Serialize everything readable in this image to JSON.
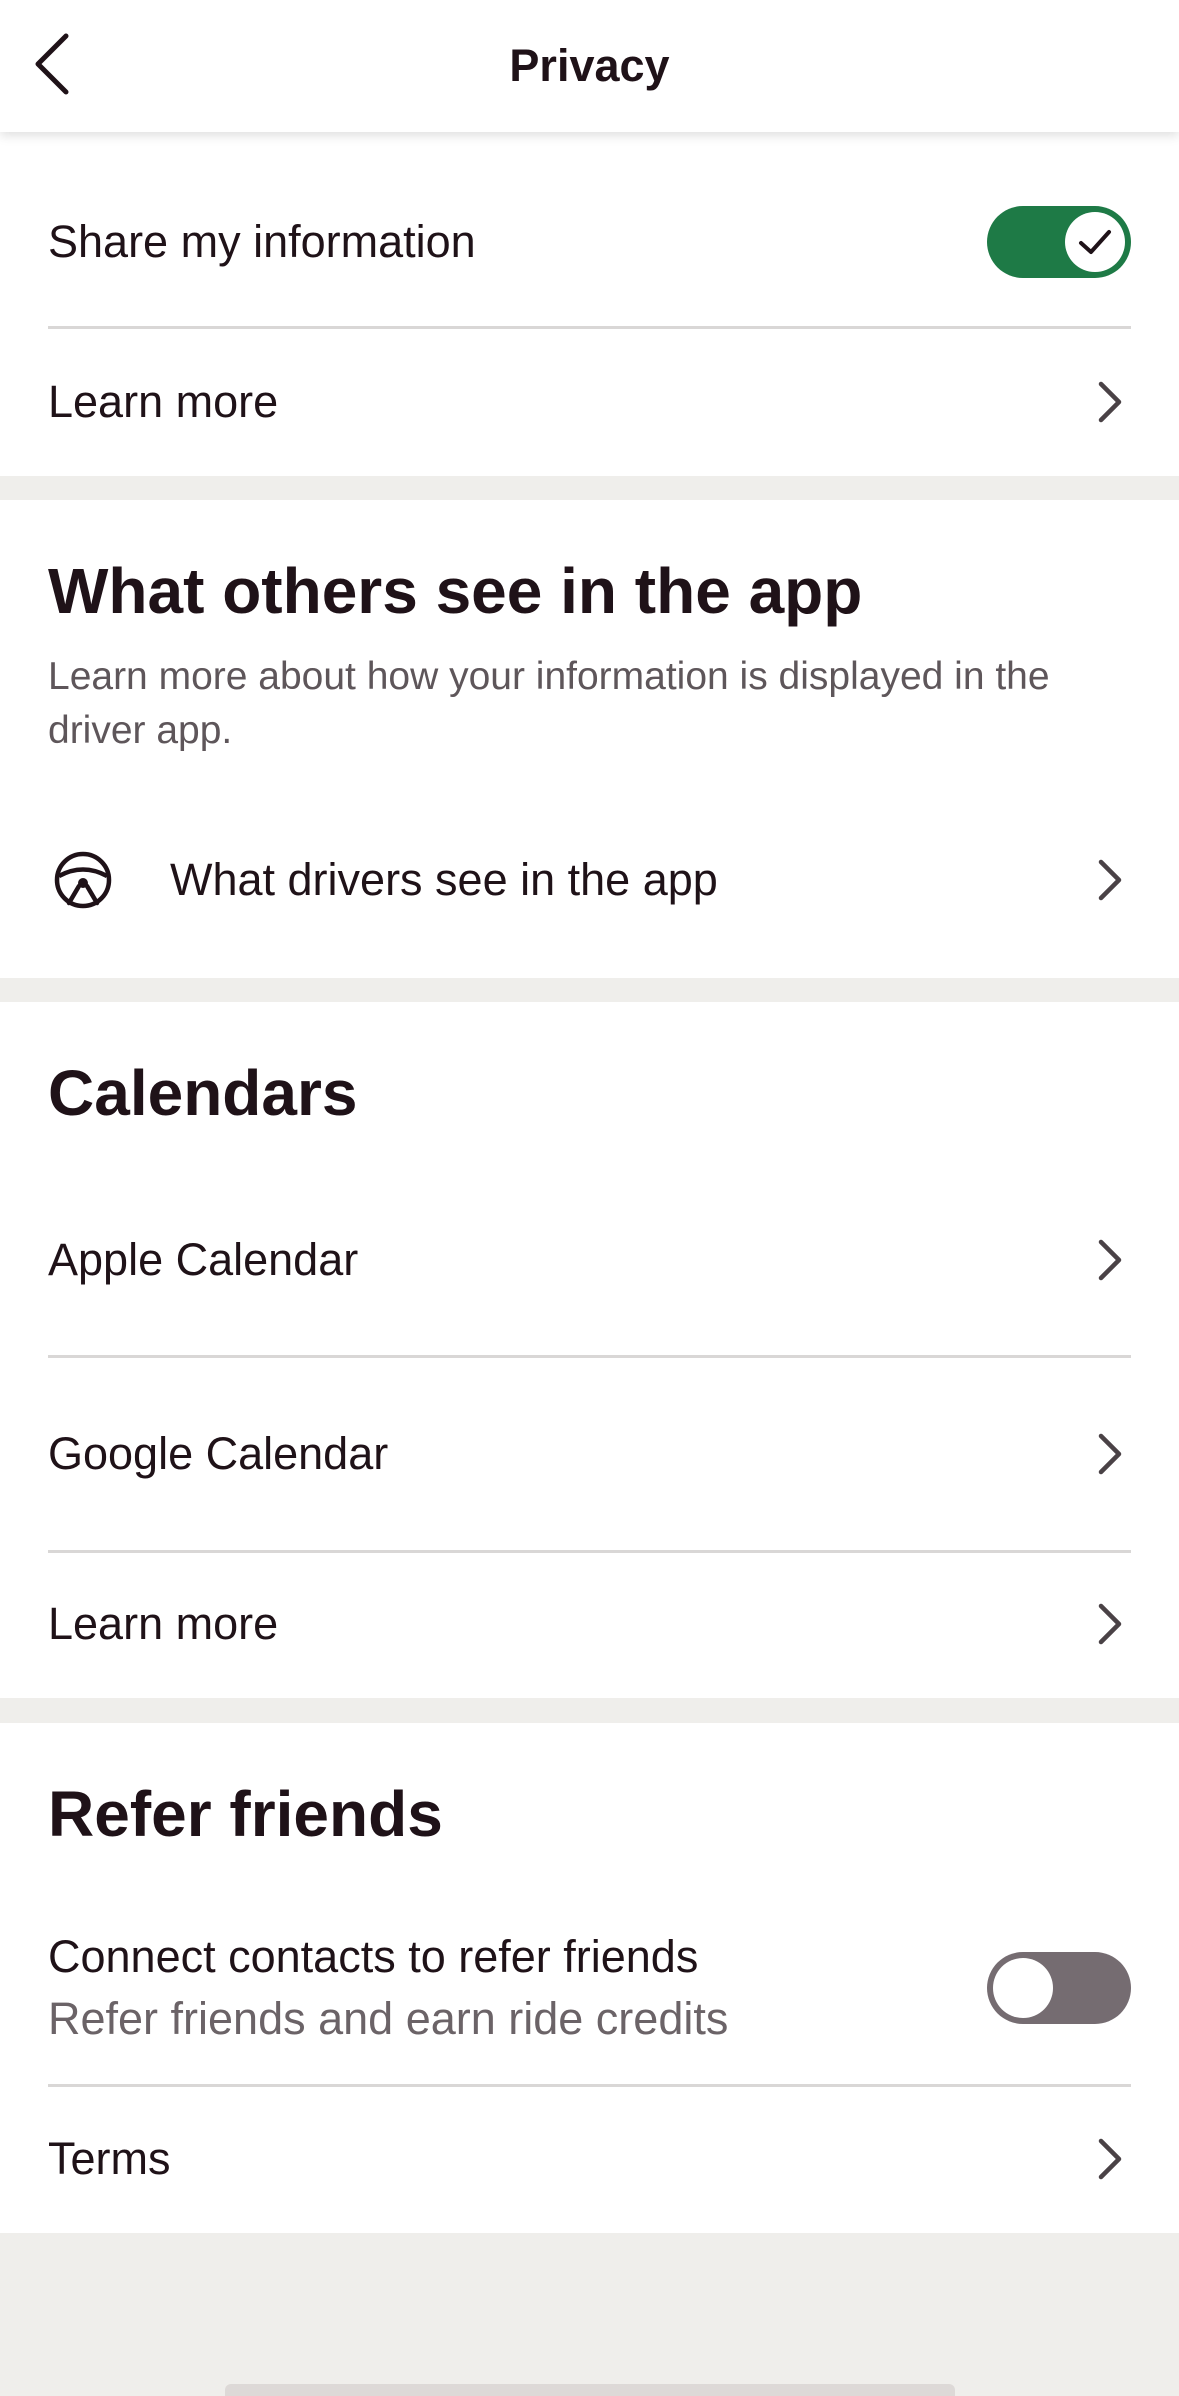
{
  "header": {
    "title": "Privacy",
    "back_icon": "chevron-left-icon"
  },
  "share": {
    "label": "Share my information",
    "toggle_on": true,
    "learn_more": "Learn more"
  },
  "others": {
    "title": "What others see in the app",
    "description": "Learn more about how your information is displayed in the driver app.",
    "drivers_label": "What drivers see in the app",
    "drivers_icon": "steering-wheel-icon"
  },
  "calendars": {
    "title": "Calendars",
    "items": [
      "Apple Calendar",
      "Google Calendar",
      "Learn more"
    ]
  },
  "refer": {
    "title": "Refer friends",
    "contacts_label": "Connect contacts to refer friends",
    "contacts_sub": "Refer friends and earn ride credits",
    "toggle_on": false,
    "terms": "Terms"
  },
  "colors": {
    "accent_green": "#1e7a46",
    "toggle_off": "#756c71",
    "text": "#1f1218",
    "background": "#efeeeb"
  }
}
